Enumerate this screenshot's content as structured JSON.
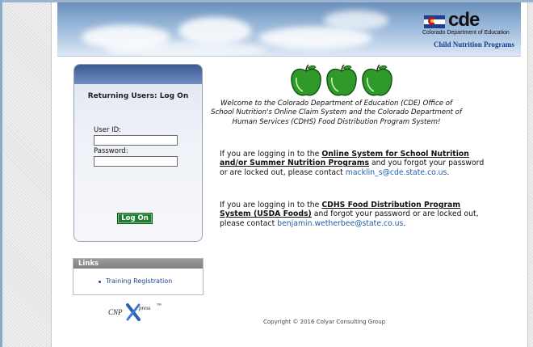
{
  "header": {
    "logo_text": "cde",
    "department": "Colorado Department of Education",
    "program": "Child Nutrition Programs"
  },
  "login": {
    "title": "Returning Users: Log On",
    "userid_label": "User ID:",
    "userid_value": "",
    "password_label": "Password:",
    "password_value": "",
    "submit_label": "Log On"
  },
  "links": {
    "heading": "Links",
    "items": [
      {
        "label": "Training Registration"
      }
    ]
  },
  "cnp_logo": {
    "text": "CNP",
    "suffix": "press",
    "trademark": "™"
  },
  "main": {
    "welcome": "Welcome to the Colorado Department of Education (CDE) Office of School Nutrition's Online Claim System and the Colorado Department of Human Services (CDHS) Food Distribution Program System!",
    "para1": {
      "pre": "If you are logging in to the ",
      "link": "Online System for School Nutrition and/or Summer Nutrition Programs",
      "post": " and you forgot your password or are locked out, please contact ",
      "email": "macklin_s@cde.state.co.us",
      "end": "."
    },
    "para2": {
      "pre": "If you are logging in to the ",
      "link": "CDHS Food Distribution Program System (USDA Foods)",
      "post": " and forgot your password or are locked out, please contact ",
      "email": "benjamin.wetherbee@state.co.us",
      "end": "."
    },
    "copyright": "Copyright © 2016 Colyar Consulting Group"
  },
  "colors": {
    "logon_button": "#1e7e2f",
    "apple": "#2f9a2a",
    "link": "#1f5ea8",
    "links_header": "#8a8a8a"
  }
}
